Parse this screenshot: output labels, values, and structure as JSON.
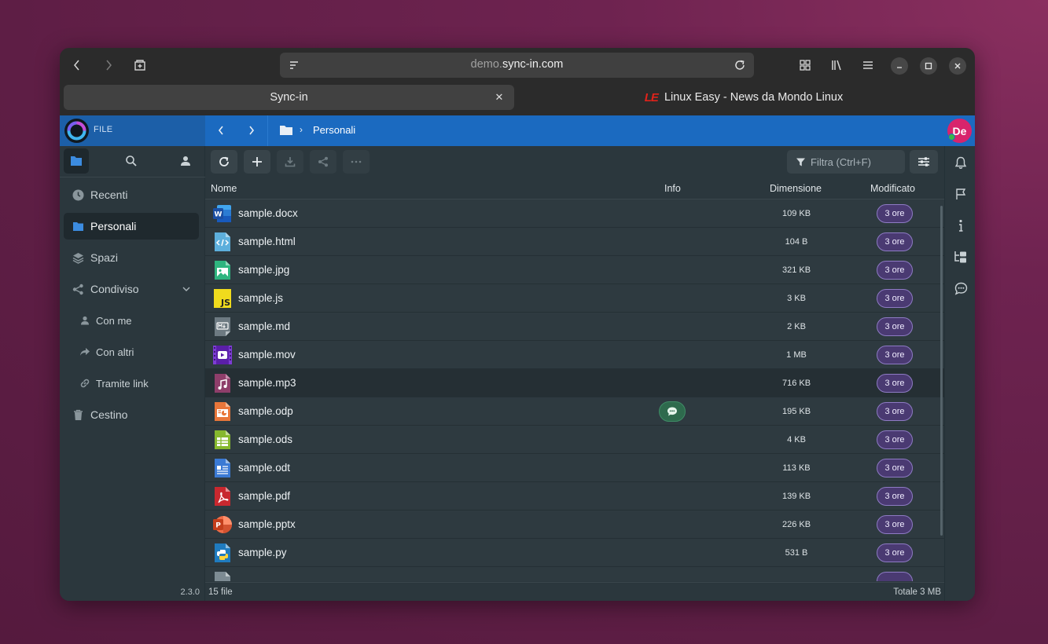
{
  "browser": {
    "url_dim": "demo.",
    "url_host": "sync-in.com",
    "tabs": [
      {
        "label": "Sync-in"
      },
      {
        "label": "Linux Easy - News da Mondo Linux",
        "logo": "LE"
      }
    ]
  },
  "app": {
    "section_label": "FILE",
    "breadcrumb": "Personali",
    "avatar_initials": "De",
    "version": "2.3.0"
  },
  "sidebar": {
    "items": [
      {
        "label": "Recenti",
        "icon": "clock-icon"
      },
      {
        "label": "Personali",
        "icon": "folder-icon"
      },
      {
        "label": "Spazi",
        "icon": "layers-icon"
      },
      {
        "label": "Condiviso",
        "icon": "share-icon"
      },
      {
        "label": "Cestino",
        "icon": "trash-icon"
      }
    ],
    "sub_items": [
      {
        "label": "Con me",
        "icon": "user-icon"
      },
      {
        "label": "Con altri",
        "icon": "reply-icon"
      },
      {
        "label": "Tramite link",
        "icon": "link-icon"
      }
    ]
  },
  "toolbar": {
    "filter_placeholder": "Filtra (Ctrl+F)"
  },
  "table": {
    "columns": {
      "name": "Nome",
      "info": "Info",
      "size": "Dimensione",
      "modified": "Modificato"
    },
    "rows": [
      {
        "name": "sample.docx",
        "size": "109 KB",
        "modified": "3 ore"
      },
      {
        "name": "sample.html",
        "size": "104 B",
        "modified": "3 ore"
      },
      {
        "name": "sample.jpg",
        "size": "321 KB",
        "modified": "3 ore"
      },
      {
        "name": "sample.js",
        "size": "3 KB",
        "modified": "3 ore"
      },
      {
        "name": "sample.md",
        "size": "2 KB",
        "modified": "3 ore"
      },
      {
        "name": "sample.mov",
        "size": "1 MB",
        "modified": "3 ore"
      },
      {
        "name": "sample.mp3",
        "size": "716 KB",
        "modified": "3 ore"
      },
      {
        "name": "sample.odp",
        "size": "195 KB",
        "modified": "3 ore"
      },
      {
        "name": "sample.ods",
        "size": "4 KB",
        "modified": "3 ore"
      },
      {
        "name": "sample.odt",
        "size": "113 KB",
        "modified": "3 ore"
      },
      {
        "name": "sample.pdf",
        "size": "139 KB",
        "modified": "3 ore"
      },
      {
        "name": "sample.pptx",
        "size": "226 KB",
        "modified": "3 ore"
      },
      {
        "name": "sample.py",
        "size": "531 B",
        "modified": "3 ore"
      }
    ]
  },
  "footer": {
    "count": "15 file",
    "total": "Totale 3 MB"
  }
}
